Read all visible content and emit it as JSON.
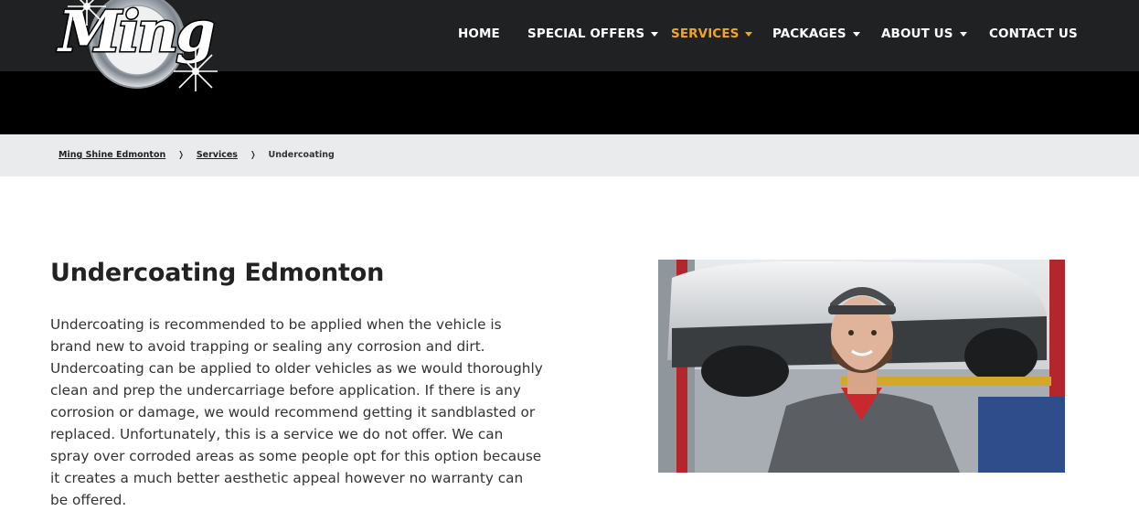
{
  "logo": {
    "text": "Ming",
    "colors": {
      "ring": "#cfd4d9",
      "letters": "#ffffff",
      "outline": "#000000"
    }
  },
  "nav": {
    "items": [
      {
        "label": "HOME",
        "has_dropdown": false,
        "active": false
      },
      {
        "label": "SPECIAL OFFERS",
        "has_dropdown": true,
        "active": false
      },
      {
        "label": "SERVICES",
        "has_dropdown": true,
        "active": true
      },
      {
        "label": "PACKAGES",
        "has_dropdown": true,
        "active": false
      },
      {
        "label": "ABOUT US",
        "has_dropdown": true,
        "active": false
      },
      {
        "label": "CONTACT US",
        "has_dropdown": false,
        "active": false
      }
    ],
    "active_color": "#f0a521"
  },
  "breadcrumb": {
    "items": [
      {
        "label": "Ming Shine Edmonton",
        "link": true
      },
      {
        "label": "Services",
        "link": true
      },
      {
        "label": "Undercoating",
        "link": false
      }
    ],
    "separator": "❭"
  },
  "main": {
    "title": "Undercoating Edmonton",
    "body": "Undercoating is recommended to be applied when the vehicle is brand new to avoid trapping or sealing any corrosion and dirt. Undercoating can be applied to older vehicles as we would thoroughly clean and prep the undercarriage before application. If there is any corrosion or damage, we would recommend getting it sandblasted or replaced. Unfortunately, this is a service we do not offer. We can spray over corroded areas as some people opt for this option because it creates a much better aesthetic appeal however no warranty can be offered."
  },
  "photo": {
    "subject": "mechanic-in-garage-photo"
  },
  "colors": {
    "header": "#1f2123",
    "hero": "#000000",
    "breadcrumb_bg": "#e9ebed",
    "text": "#333333"
  }
}
